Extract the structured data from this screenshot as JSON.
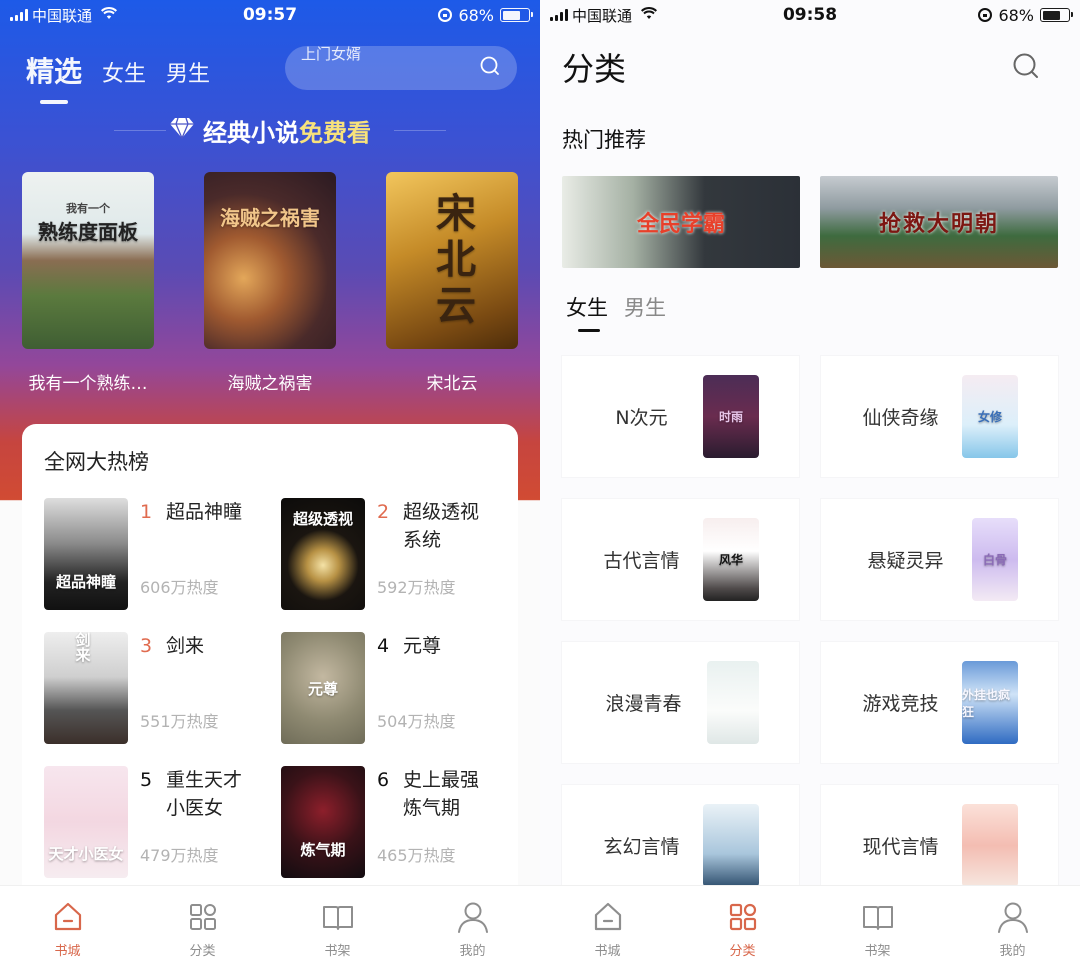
{
  "left_screen": {
    "status_bar": {
      "carrier": "中国联通",
      "time": "09:57",
      "battery": "68%",
      "battery_level": 0.68
    },
    "top_tabs": [
      {
        "label": "精选",
        "active": true
      },
      {
        "label": "女生",
        "active": false
      },
      {
        "label": "男生",
        "active": false
      }
    ],
    "search": {
      "placeholder": "上门女婿",
      "icon": "search-icon"
    },
    "promo": {
      "icon": "diamond-icon",
      "title_main": "经典小说",
      "title_highlight": "免费看"
    },
    "free_books": [
      {
        "title": "我有一个熟练…",
        "cover_text": "熟练度面板",
        "cover_subtitle": "我有一个"
      },
      {
        "title": "海贼之祸害",
        "cover_text": "海贼之祸害"
      },
      {
        "title": "宋北云",
        "cover_text": "宋北云"
      }
    ],
    "hot_list": {
      "title": "全网大热榜",
      "items": [
        {
          "rank": "1",
          "name": "超品神瞳",
          "heat": "606万热度",
          "cover_text": "超品神瞳",
          "top": true
        },
        {
          "rank": "2",
          "name": "超级透视系统",
          "heat": "592万热度",
          "cover_text": "超级透视",
          "top": true
        },
        {
          "rank": "3",
          "name": "剑来",
          "heat": "551万热度",
          "cover_text": "剑来",
          "top": true
        },
        {
          "rank": "4",
          "name": "元尊",
          "heat": "504万热度",
          "cover_text": "元尊",
          "top": false
        },
        {
          "rank": "5",
          "name": "重生天才小医女",
          "heat": "479万热度",
          "cover_text": "天才小医女",
          "top": false
        },
        {
          "rank": "6",
          "name": "史上最强炼气期",
          "heat": "465万热度",
          "cover_text": "炼气期",
          "top": false
        }
      ]
    },
    "tabbar": [
      {
        "label": "书城",
        "icon": "home-icon",
        "active": true
      },
      {
        "label": "分类",
        "icon": "grid-icon",
        "active": false
      },
      {
        "label": "书架",
        "icon": "book-icon",
        "active": false
      },
      {
        "label": "我的",
        "icon": "user-icon",
        "active": false
      }
    ]
  },
  "right_screen": {
    "status_bar": {
      "carrier": "中国联通",
      "time": "09:58",
      "battery": "68%",
      "battery_level": 0.68
    },
    "page_title": "分类",
    "section_title": "热门推荐",
    "banners": [
      {
        "title": "全民学霸"
      },
      {
        "title": "抢救大明朝"
      }
    ],
    "gender_tabs": [
      {
        "label": "女生",
        "active": true
      },
      {
        "label": "男生",
        "active": false
      }
    ],
    "categories": [
      {
        "name": "N次元",
        "cover_text": "时雨"
      },
      {
        "name": "仙侠奇缘",
        "cover_text": "女修"
      },
      {
        "name": "古代言情",
        "cover_text": "风华"
      },
      {
        "name": "悬疑灵异",
        "cover_text": "白骨"
      },
      {
        "name": "浪漫青春",
        "cover_text": ""
      },
      {
        "name": "游戏竞技",
        "cover_text": "外挂也疯狂"
      },
      {
        "name": "玄幻言情",
        "cover_text": ""
      },
      {
        "name": "现代言情",
        "cover_text": ""
      }
    ],
    "tabbar": [
      {
        "label": "书城",
        "icon": "home-icon",
        "active": false
      },
      {
        "label": "分类",
        "icon": "grid-icon",
        "active": true
      },
      {
        "label": "书架",
        "icon": "book-icon",
        "active": false
      },
      {
        "label": "我的",
        "icon": "user-icon",
        "active": false
      }
    ]
  },
  "colors": {
    "accent": "#d8674b",
    "rank_top": "#e06b4f",
    "promo_highlight": "#f7e27c",
    "gradient_top": "#1d5ae8",
    "gradient_bottom": "#d14b33"
  }
}
